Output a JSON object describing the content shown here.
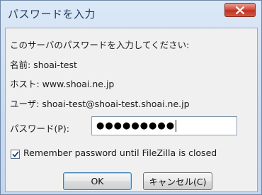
{
  "window": {
    "title": "パスワードを入力",
    "close_glyph": "X"
  },
  "dialog": {
    "prompt": "このサーバのパスワードを入力してください:",
    "name_line": "名前:  shoai-test",
    "host_line": "ホスト:  www.shoai.ne.jp",
    "user_line": "ユーザ:  shoai-test@shoai-test.shoai.ne.jp",
    "password_label": "パスワード(P):",
    "password_value": "●●●●●●●●●",
    "remember_label": "Remember password until FileZilla is closed",
    "remember_checked": true,
    "ok_label": "OK",
    "cancel_label": "キャンセル(C)"
  },
  "colors": {
    "frame": "#c8daf0",
    "close_button": "#c73e2e",
    "ok_focus": "#3c7fb1"
  },
  "icons": [
    "close-icon",
    "checkmark-icon"
  ]
}
